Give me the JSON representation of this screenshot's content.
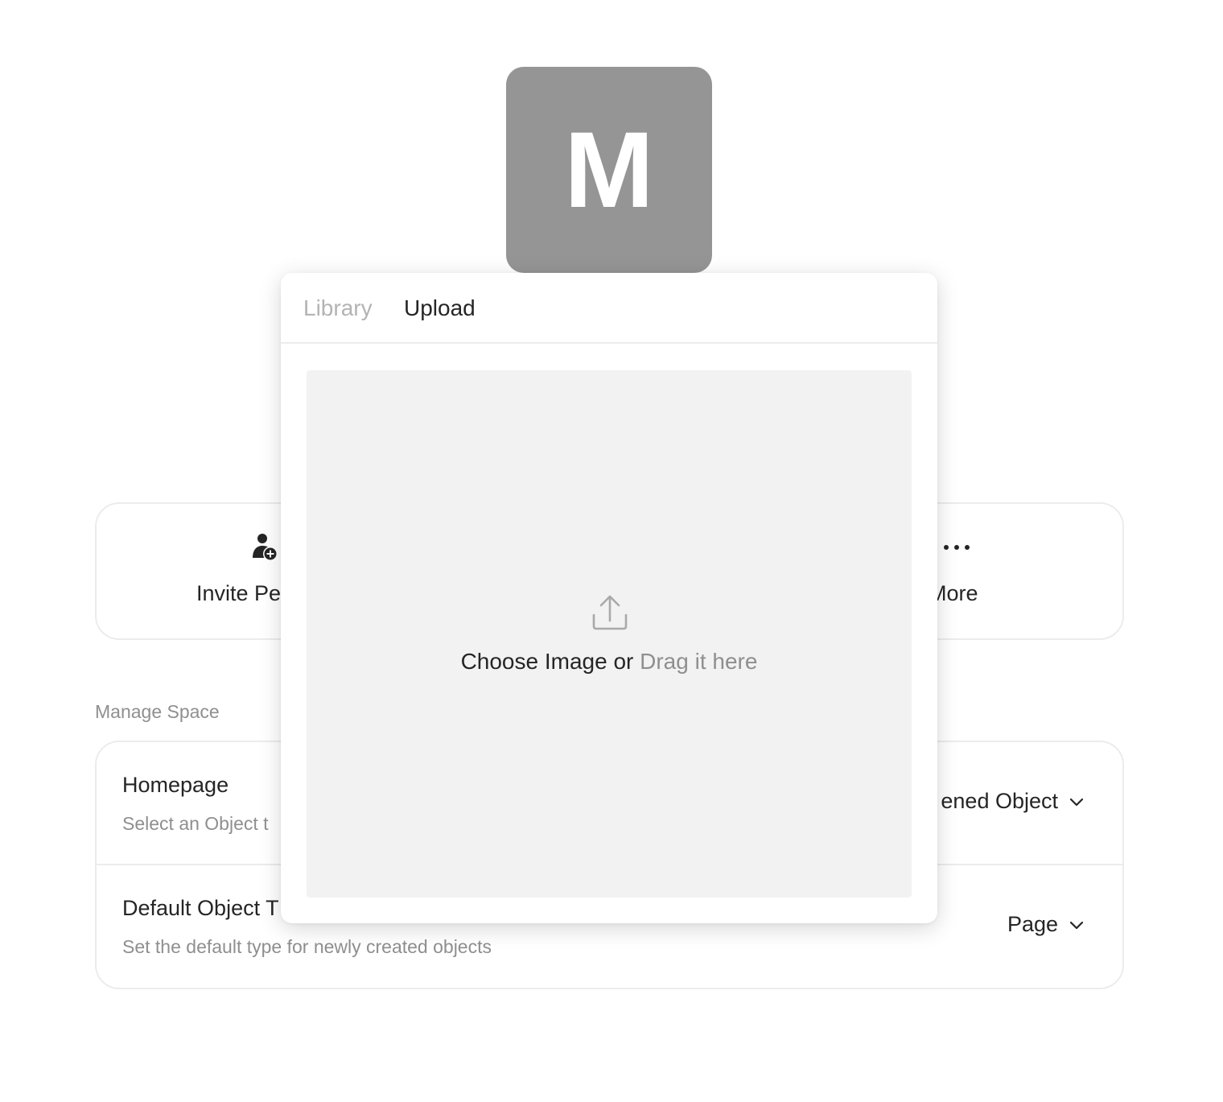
{
  "space": {
    "icon_letter": "M",
    "icon_color": "#959595"
  },
  "actions": {
    "invite": {
      "label": "Invite Pe",
      "icon": "user-add-icon"
    },
    "more": {
      "label": "More",
      "icon": "more-dots-icon"
    }
  },
  "manage": {
    "section_title": "Manage Space",
    "rows": [
      {
        "title": "Homepage",
        "description": "Select an Object t",
        "value": "ened Object"
      },
      {
        "title": "Default Object T",
        "description": "Set the default type for newly created objects",
        "value": "Page"
      }
    ]
  },
  "popup": {
    "tabs": [
      {
        "label": "Library",
        "active": false
      },
      {
        "label": "Upload",
        "active": true
      }
    ],
    "dropzone": {
      "icon": "upload-icon",
      "choose_text": "Choose Image or ",
      "drag_text": "Drag it here"
    }
  }
}
